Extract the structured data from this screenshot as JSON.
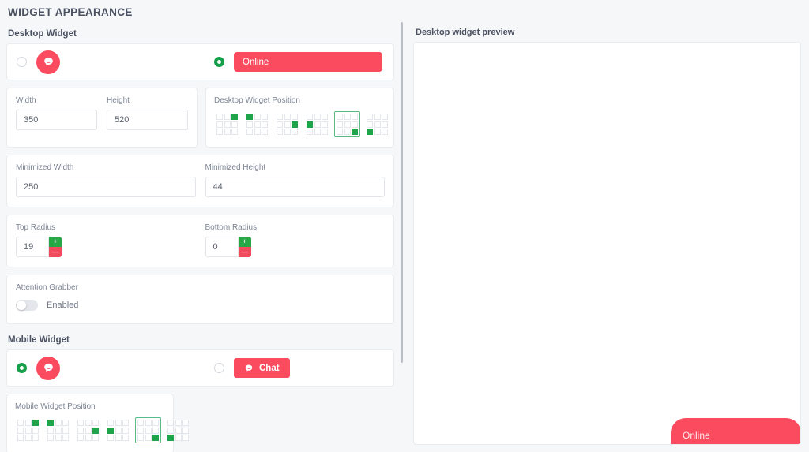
{
  "page": {
    "title": "WIDGET APPEARANCE"
  },
  "desktop": {
    "section_label": "Desktop Widget",
    "styles": [
      {
        "type": "bubble-icon",
        "selected": false,
        "icon": "chat-bubble-icon"
      },
      {
        "type": "online-bar",
        "selected": true,
        "label": "Online"
      }
    ],
    "width": {
      "label": "Width",
      "value": "350"
    },
    "height": {
      "label": "Height",
      "value": "520"
    },
    "position": {
      "label": "Desktop Widget Position",
      "selected_index": 4,
      "options": [
        {
          "name": "top-right",
          "cell": 2
        },
        {
          "name": "top-left",
          "cell": 0
        },
        {
          "name": "middle-right",
          "cell": 5
        },
        {
          "name": "middle-left",
          "cell": 3
        },
        {
          "name": "bottom-right",
          "cell": 8
        },
        {
          "name": "bottom-left",
          "cell": 6
        }
      ]
    },
    "minimized_width": {
      "label": "Minimized Width",
      "value": "250"
    },
    "minimized_height": {
      "label": "Minimized Height",
      "value": "44"
    },
    "top_radius": {
      "label": "Top Radius",
      "value": "19"
    },
    "bottom_radius": {
      "label": "Bottom Radius",
      "value": "0"
    },
    "attention_grabber": {
      "label": "Attention Grabber",
      "toggle_label": "Enabled",
      "enabled": false
    }
  },
  "mobile": {
    "section_label": "Mobile Widget",
    "styles": [
      {
        "type": "bubble-icon",
        "selected": true,
        "icon": "chat-bubble-icon"
      },
      {
        "type": "chat-button",
        "selected": false,
        "label": "Chat",
        "icon": "chat-bubble-icon"
      }
    ],
    "position": {
      "label": "Mobile Widget Position",
      "selected_index": 4,
      "options": [
        {
          "name": "top-right",
          "cell": 2
        },
        {
          "name": "top-left",
          "cell": 0
        },
        {
          "name": "middle-right",
          "cell": 5
        },
        {
          "name": "middle-left",
          "cell": 3
        },
        {
          "name": "bottom-right",
          "cell": 8
        },
        {
          "name": "bottom-left",
          "cell": 6
        }
      ]
    }
  },
  "preview": {
    "label": "Desktop widget preview",
    "widget_label": "Online"
  },
  "stepper": {
    "increment": "+",
    "decrement": "—"
  },
  "colors": {
    "accent_red": "#fb4b5f",
    "accent_green": "#1fa34b",
    "text_dark": "#4a5160",
    "text_muted": "#7c8494",
    "page_bg": "#f6f7f9"
  }
}
